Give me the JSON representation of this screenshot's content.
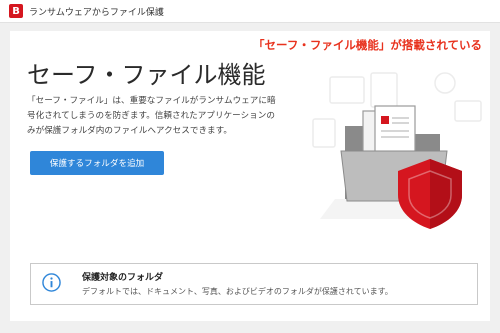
{
  "window": {
    "logo_letter": "B",
    "title": "ランサムウェアからファイル保護"
  },
  "annotation": "「セーフ・ファイル機能」が搭載されている",
  "main": {
    "title": "セーフ・ファイル機能",
    "description": "「セーフ・ファイル」は、重要なファイルがランサムウェアに暗号化されてしまうのを防ぎます。信頼されたアプリケーションのみが保護フォルダ内のファイルへアクセスできます。",
    "add_button_label": "保護するフォルダを追加"
  },
  "illustration": {
    "icon": "protected-folder-shield-icon",
    "shield_color": "#d5161f"
  },
  "info": {
    "icon": "info-icon",
    "title": "保護対象のフォルダ",
    "text": "デフォルトでは、ドキュメント、写真、およびビデオのフォルダが保護されています。"
  },
  "colors": {
    "accent": "#2f86d9",
    "brand": "#d5161f",
    "annotation": "#e8321e"
  }
}
